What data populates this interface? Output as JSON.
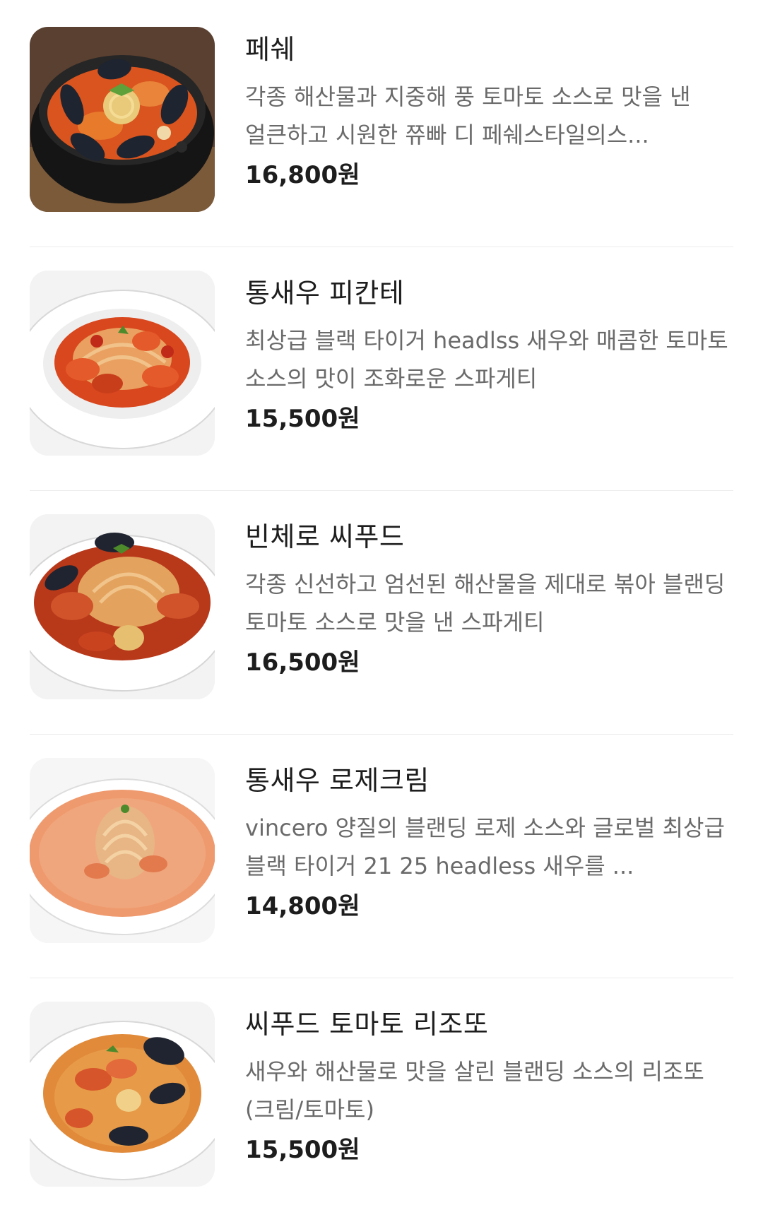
{
  "menu": {
    "items": [
      {
        "name": "페쉐",
        "description": "각종 해산물과 지중해 풍 토마토 소스로 맛을 낸 얼큰하고 시원한 쮸빠 디 페쉐스타일의스...",
        "price": "16,800원",
        "image": "seafood-stew-photo"
      },
      {
        "name": "통새우 피칸테",
        "description": "최상급 블랙 타이거 headlss 새우와 매콤한 토마토 소스의 맛이 조화로운 스파게티",
        "price": "15,500원",
        "image": "shrimp-spaghetti-photo"
      },
      {
        "name": "빈체로 씨푸드",
        "description": "각종 신선하고 엄선된 해산물을 제대로 볶아 블랜딩 토마토 소스로 맛을 낸 스파게티",
        "price": "16,500원",
        "image": "seafood-spaghetti-photo"
      },
      {
        "name": "통새우 로제크림",
        "description": "vincero 양질의 블랜딩 로제 소스와 글로벌 최상급 블랙 타이거 21 25 headless 새우를 ...",
        "price": "14,800원",
        "image": "rose-cream-pasta-photo"
      },
      {
        "name": "씨푸드 토마토 리조또",
        "description": "새우와 해산물로 맛을 살린 블랜딩 소스의 리조또 (크림/토마토)",
        "price": "15,500원",
        "image": "seafood-risotto-photo"
      }
    ]
  }
}
